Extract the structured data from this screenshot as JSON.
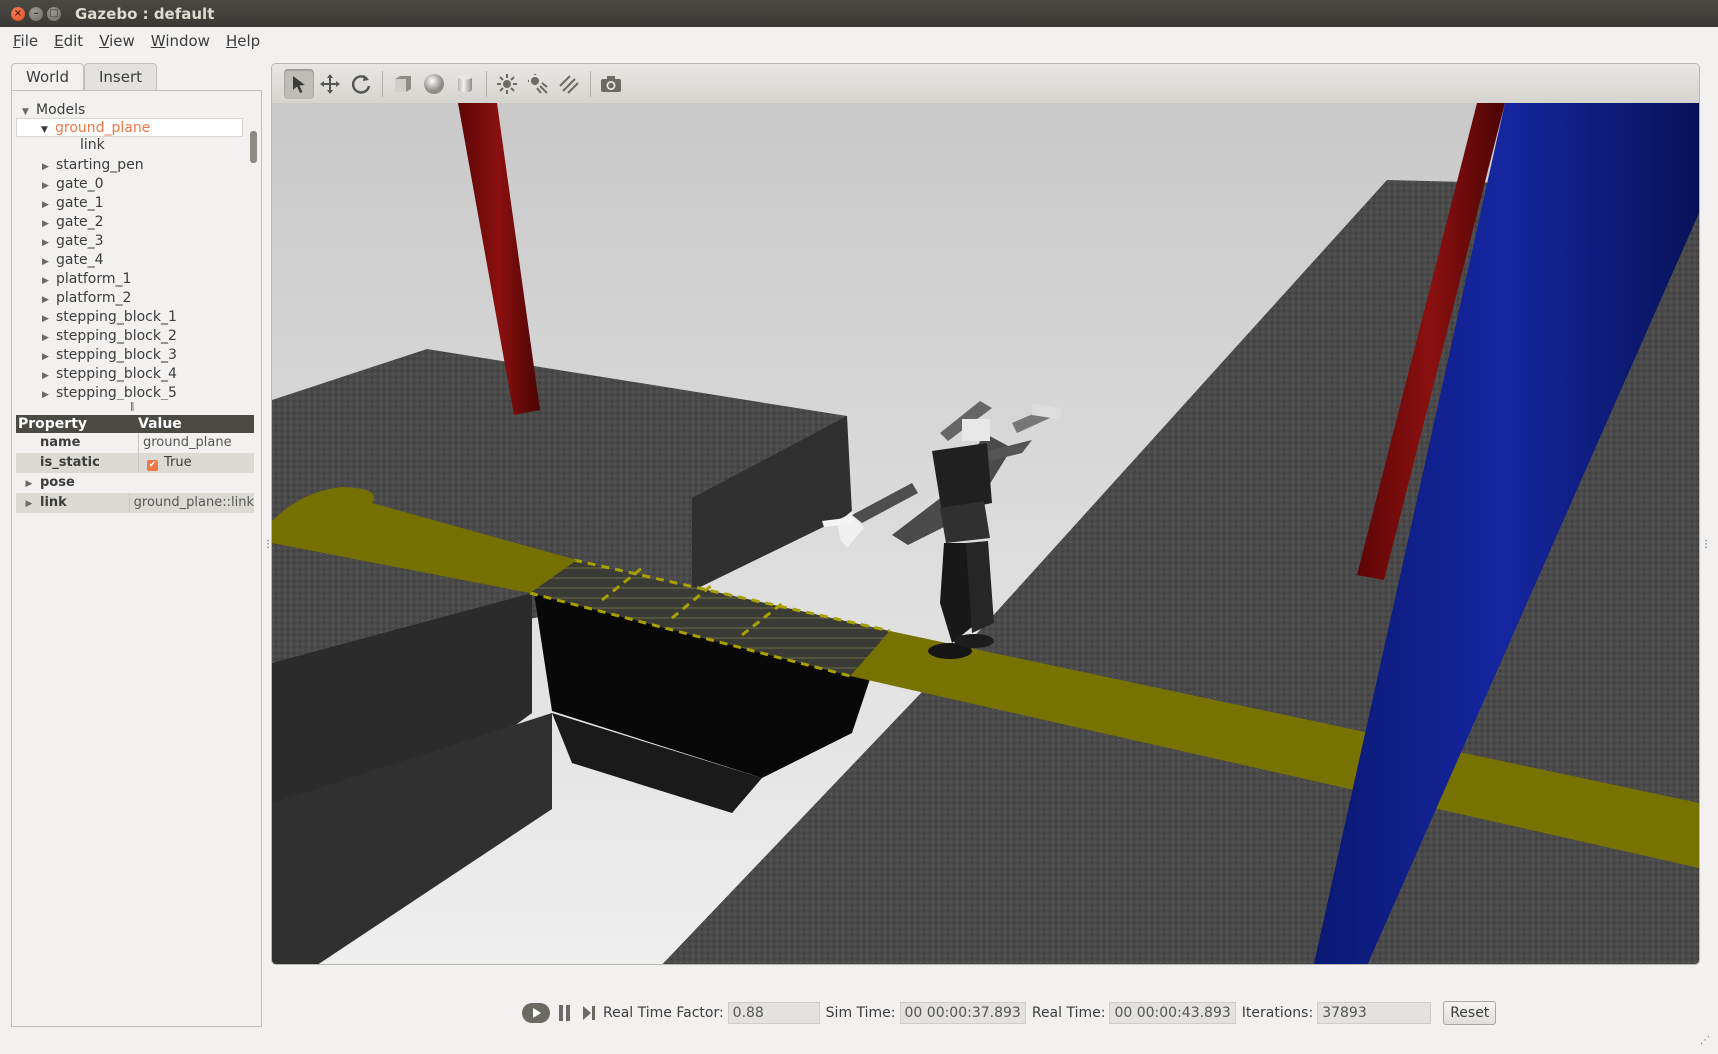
{
  "window": {
    "title": "Gazebo : default",
    "controls": [
      "close-icon",
      "minimize-icon",
      "maximize-icon"
    ]
  },
  "menu": [
    "File",
    "Edit",
    "View",
    "Window",
    "Help"
  ],
  "tabs": [
    {
      "label": "World",
      "active": true
    },
    {
      "label": "Insert",
      "active": false
    }
  ],
  "tree": {
    "root": "Models",
    "selected": "ground_plane",
    "selected_child": "link",
    "items": [
      "starting_pen",
      "gate_0",
      "gate_1",
      "gate_2",
      "gate_3",
      "gate_4",
      "platform_1",
      "platform_2",
      "stepping_block_1",
      "stepping_block_2",
      "stepping_block_3",
      "stepping_block_4",
      "stepping_block_5"
    ]
  },
  "properties": {
    "header_property": "Property",
    "header_value": "Value",
    "rows": [
      {
        "key": "name",
        "value": "ground_plane"
      },
      {
        "key": "is_static",
        "value": "True",
        "checked": true
      },
      {
        "key": "pose",
        "value": ""
      },
      {
        "key": "link",
        "value": "ground_plane::link"
      }
    ]
  },
  "toolbar": {
    "tools": [
      "select-arrow-icon",
      "translate-icon",
      "rotate-icon",
      "box-shape-icon",
      "sphere-shape-icon",
      "cylinder-shape-icon",
      "point-light-icon",
      "spot-light-icon",
      "directional-light-icon",
      "screenshot-camera-icon"
    ],
    "active_tool": "select-arrow-icon"
  },
  "status": {
    "real_time_factor_label": "Real Time Factor:",
    "real_time_factor": "0.88",
    "sim_time_label": "Sim Time:",
    "sim_time": "00 00:00:37.893",
    "real_time_label": "Real Time:",
    "real_time": "00 00:00:43.893",
    "iterations_label": "Iterations:",
    "iterations": "37893",
    "reset_label": "Reset"
  },
  "colors": {
    "selection": "#f07746",
    "yellow_path": "#7f7a00",
    "red_pillar": "#7a0a0a",
    "blue_pillar": "#0a1a80"
  }
}
